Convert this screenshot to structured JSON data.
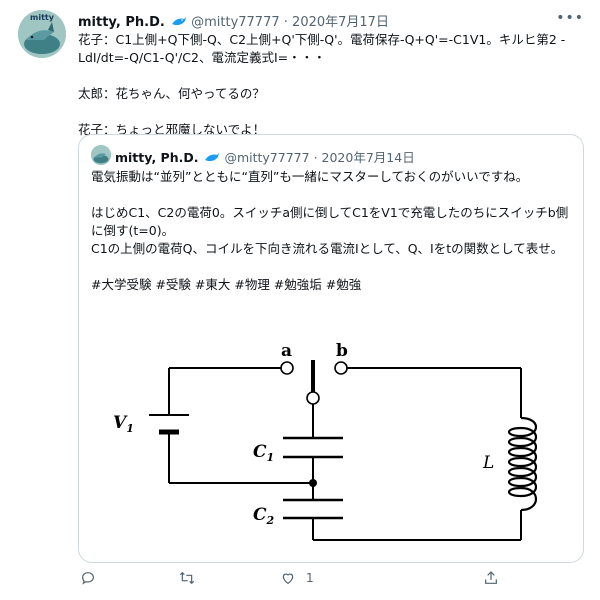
{
  "tweet": {
    "avatar_text": "mitty",
    "name": "mitty, Ph.D.",
    "handle": "@mitty77777",
    "separator": "·",
    "date": "2020年7月17日",
    "more_icon": "more-horizontal-icon",
    "lines": [
      "花子：C1上側+Q下側-Q、C2上側+Q'下側-Q'。電荷保存-Q+Q'=-C1V1。キルヒ第2 -LdI/dt=-Q/C1-Q'/C2、電流定義式I=・・・",
      "太郎：花ちゃん、何やってるの？",
      "花子：ちょっと邪魔しないでよ！"
    ]
  },
  "quote": {
    "name": "mitty, Ph.D.",
    "handle": "@mitty77777",
    "separator": "·",
    "date": "2020年7月14日",
    "paragraph1": "電気振動は“並列”とともに“直列”も一緒にマスターしておくのがいいですね。",
    "paragraph2_line1": "はじめC1、C2の電荷0。スイッチa側に倒してC1をV1で充電したのちにスイッチb側に倒す(t=0)。",
    "paragraph2_line2": "C1の上側の電荷Q、コイルを下向き流れる電流Iとして、Q、Iをtの関数として表せ。",
    "hashtags": "#大学受験 #受験 #東大 #物理 #勉強垢 #勉強"
  },
  "circuit_labels": {
    "switch_a": "a",
    "switch_b": "b",
    "battery": "V",
    "battery_sub": "1",
    "cap1": "C",
    "cap1_sub": "1",
    "cap2": "C",
    "cap2_sub": "2",
    "inductor": "L"
  },
  "actions": {
    "reply_icon": "reply-icon",
    "retweet_icon": "retweet-icon",
    "like_icon": "heart-icon",
    "like_count": "1",
    "share_icon": "share-icon"
  },
  "colors": {
    "verified": "#1d9bf0",
    "secondary_text": "#536471",
    "border": "#cfd9de"
  }
}
